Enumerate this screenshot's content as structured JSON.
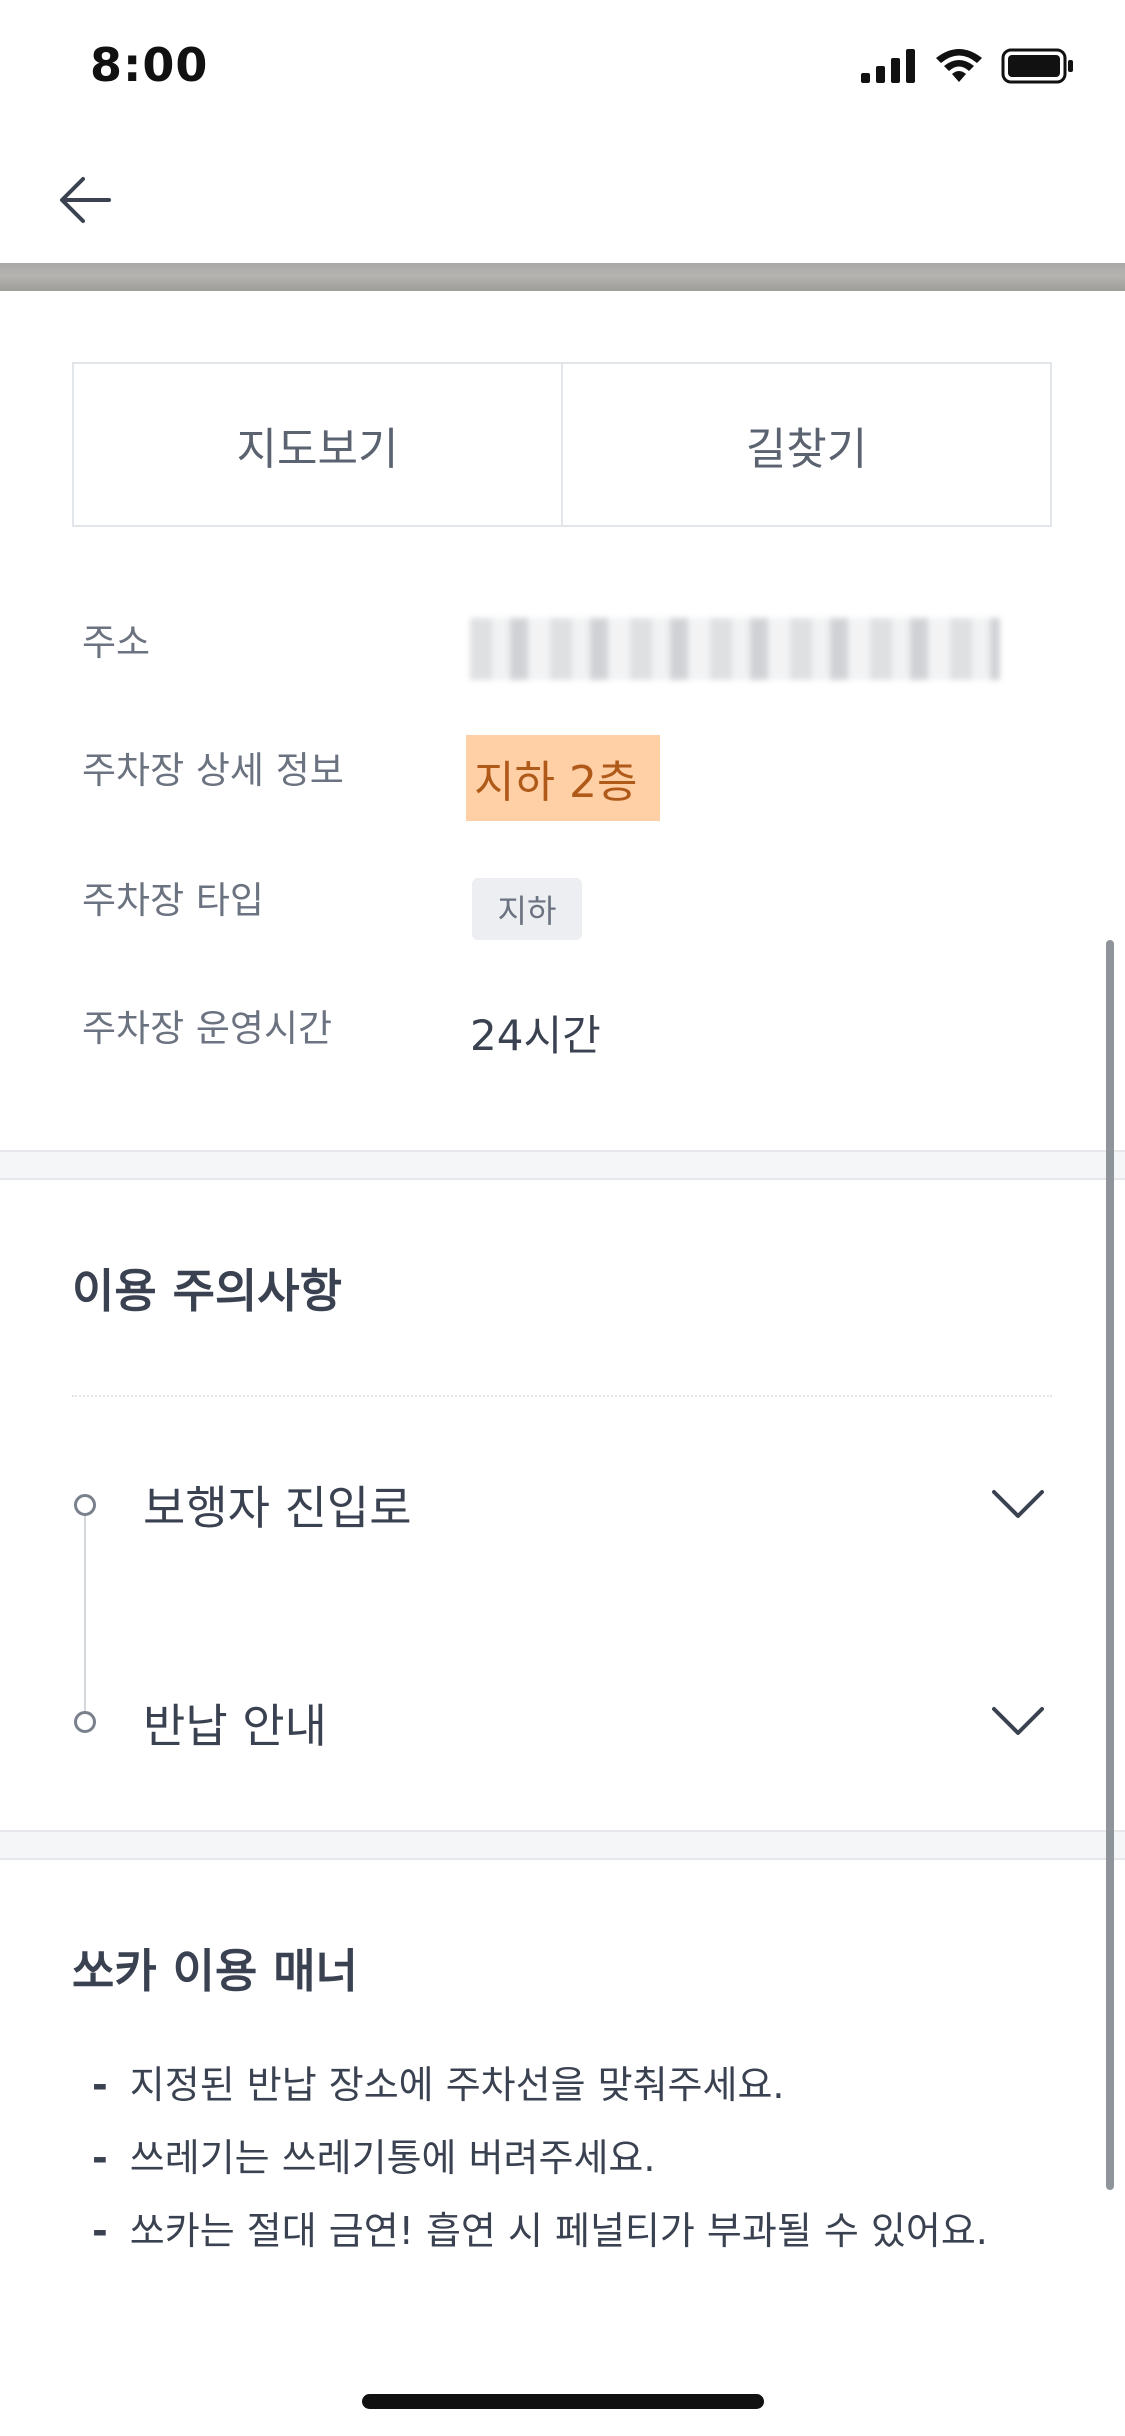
{
  "status_bar": {
    "time": "8:00"
  },
  "header": {
    "back_icon": "arrow-left-icon"
  },
  "actions": {
    "map_label": "지도보기",
    "route_label": "길찾기"
  },
  "info": {
    "address_label": "주소",
    "detail_label": "주차장 상세 정보",
    "detail_value": "지하 2층",
    "type_label": "주차장 타입",
    "type_tag": "지하",
    "hours_label": "주차장 운영시간",
    "hours_value": "24시간"
  },
  "caution": {
    "title": "이용 주의사항",
    "items": [
      {
        "label": "보행자 진입로",
        "icon": "chevron-down-icon"
      },
      {
        "label": "반납 안내",
        "icon": "chevron-down-icon"
      }
    ]
  },
  "manners": {
    "title": "쏘카 이용 매너",
    "items": [
      "지정된 반납 장소에 주차선을 맞춰주세요.",
      "쓰레기는 쓰레기통에 버려주세요.",
      "쏘카는 절대 금연! 흡연 시 페널티가 부과될 수 있어요."
    ]
  },
  "colors": {
    "highlight": "#ffcfa6",
    "accent_text": "#b05a1a"
  }
}
